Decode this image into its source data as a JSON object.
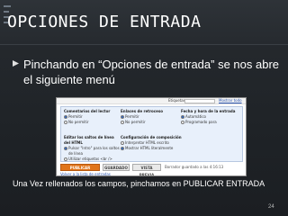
{
  "slide": {
    "title": "OPCIONES DE ENTRADA",
    "bullet": "Pinchando en “Opciones de entrada” se nos abre el siguiente menú",
    "caption": "Una Vez rellenados los campos, pinchamos en PUBLICAR ENTRADA",
    "page_number": "24"
  },
  "screenshot": {
    "tags_label": "Etiquetas:",
    "show_all": "Mostrar todo",
    "columns": [
      {
        "heading": "Comentarios del lector",
        "options": [
          "Permitir",
          "No permitir"
        ],
        "selected": 0
      },
      {
        "heading": "Enlaces de retroceso",
        "options": [
          "Permitir",
          "No permitir"
        ],
        "selected": 0
      },
      {
        "heading": "Fecha y hora de la entrada",
        "options": [
          "Automático",
          "Programado para"
        ],
        "selected": 0
      }
    ],
    "columns_lower": [
      {
        "heading": "Editar los saltos de línea del HTML",
        "options": [
          "Pulsar \"Intro\" para los saltos de línea",
          "Utilizar etiquetas <br />"
        ],
        "selected": 0
      },
      {
        "heading": "Configuración de composición",
        "options": [
          "Interpretar HTML escrito",
          "Mostrar HTML literalmente"
        ],
        "selected": 1
      }
    ],
    "buttons": {
      "publish": "PUBLICAR ENTRADA",
      "save": "GUARDADO",
      "preview": "VISTA PREVIA"
    },
    "saved_note": "Borrador guardado a las 4:16:13",
    "back_link": "Volver a la lista de entradas"
  },
  "colors": {
    "background": "#1e2226",
    "publish_button": "#e0741a",
    "options_panel": "#e8f0fb"
  }
}
